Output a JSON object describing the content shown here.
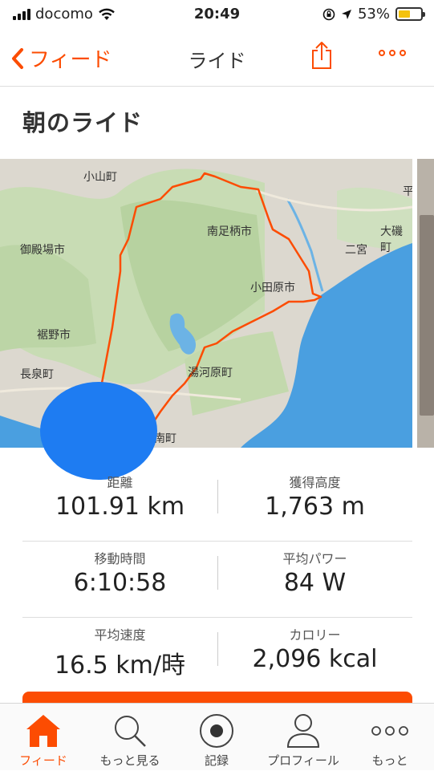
{
  "status_bar": {
    "carrier": "docomo",
    "time": "20:49",
    "battery_percent": "53%",
    "battery_level": 0.53
  },
  "nav": {
    "back_label": "フィード",
    "title": "ライド"
  },
  "activity": {
    "title": "朝のライド"
  },
  "map": {
    "places": [
      "小山町",
      "南足柄市",
      "御殿場市",
      "二宮",
      "大磯町",
      "小田原市",
      "裾野市",
      "長泉町",
      "湯河原町",
      "南町",
      "平"
    ],
    "route_color": "#fc4c02",
    "sea_color": "#4a9fe0",
    "land_color": "#cfe0bf"
  },
  "stats": [
    {
      "left": {
        "label": "距離",
        "value": "101.91 km"
      },
      "right": {
        "label": "獲得高度",
        "value": "1,763 m"
      }
    },
    {
      "left": {
        "label": "移動時間",
        "value": "6:10:58"
      },
      "right": {
        "label": "平均パワー",
        "value": "84 W"
      }
    },
    {
      "left": {
        "label": "平均速度",
        "value": "16.5 km/時"
      },
      "right": {
        "label": "カロリー",
        "value": "2,096 kcal"
      }
    }
  ],
  "tabs": [
    {
      "label": "フィード",
      "icon": "home-icon",
      "active": true
    },
    {
      "label": "もっと見る",
      "icon": "search-icon"
    },
    {
      "label": "記録",
      "icon": "record-icon"
    },
    {
      "label": "プロフィール",
      "icon": "profile-icon"
    },
    {
      "label": "もっと",
      "icon": "more-icon"
    }
  ],
  "colors": {
    "accent": "#fc4c02",
    "redaction": "#1e7cf2"
  }
}
